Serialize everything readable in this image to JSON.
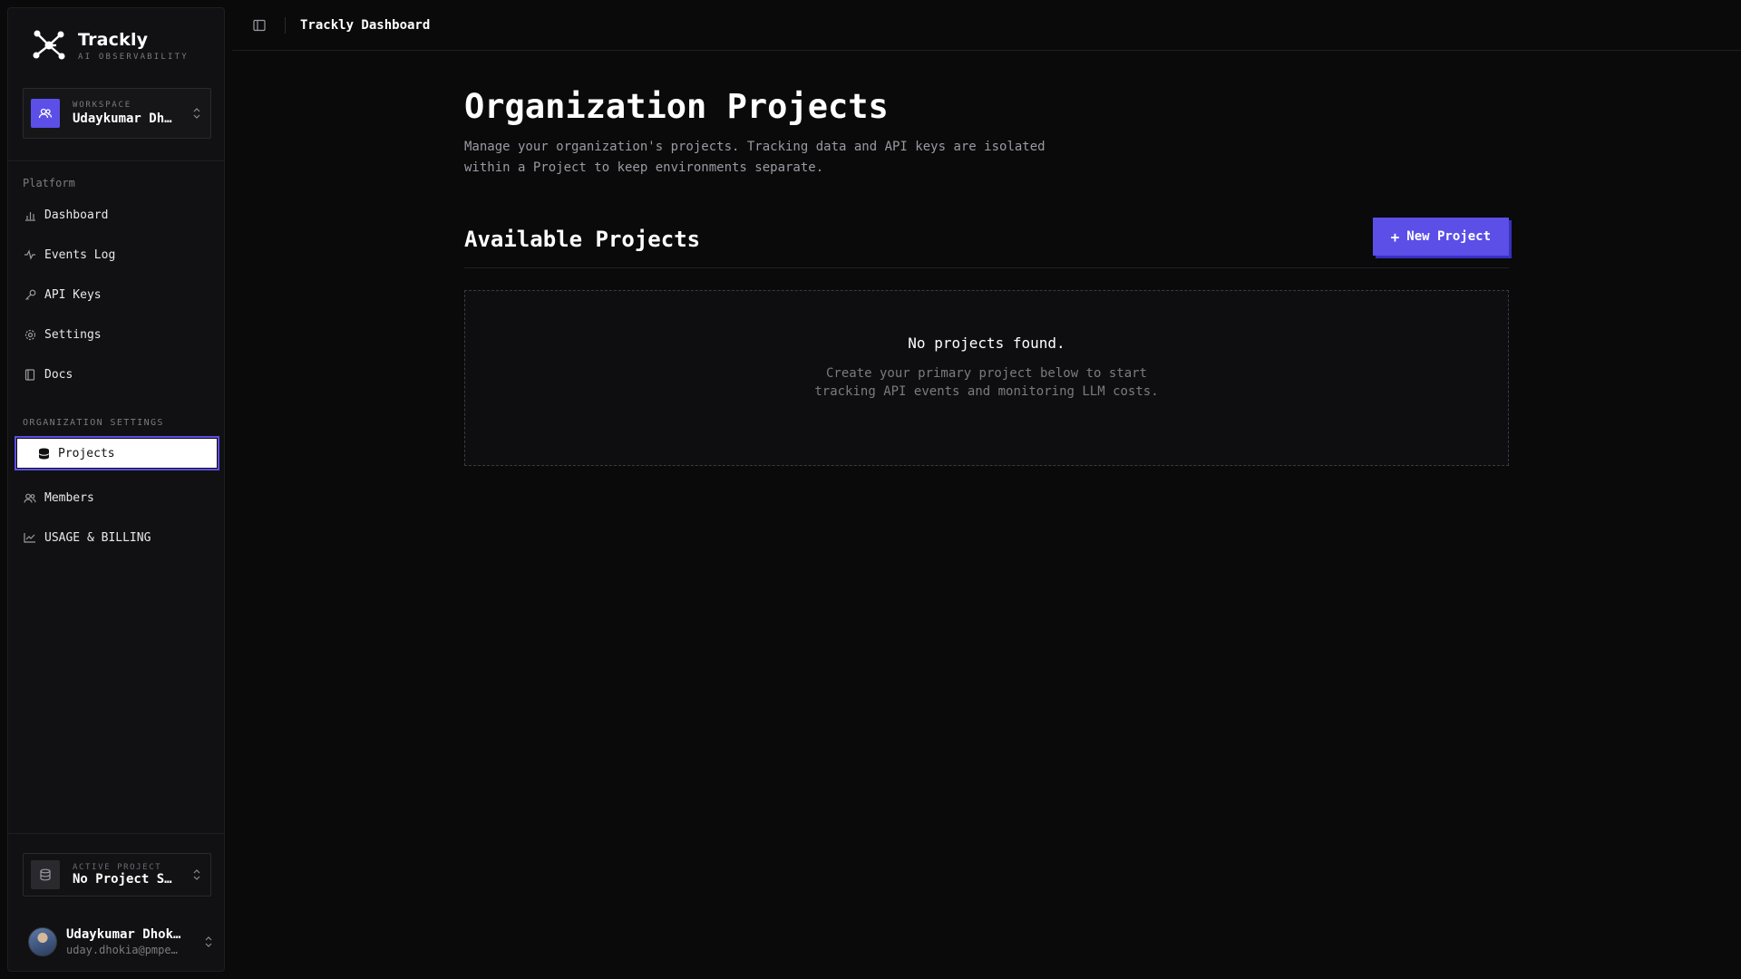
{
  "brand": {
    "name": "Trackly",
    "tagline": "AI OBSERVABILITY"
  },
  "workspace": {
    "label": "WORKSPACE",
    "name": "Udaykumar Dh…"
  },
  "nav": {
    "platform_label": "Platform",
    "platform_items": [
      {
        "label": "Dashboard",
        "icon": "bar-chart-icon"
      },
      {
        "label": "Events Log",
        "icon": "activity-icon"
      },
      {
        "label": "API Keys",
        "icon": "key-icon"
      },
      {
        "label": "Settings",
        "icon": "gear-icon"
      },
      {
        "label": "Docs",
        "icon": "book-icon"
      }
    ],
    "org_label": "ORGANIZATION SETTINGS",
    "org_items": [
      {
        "label": "Projects",
        "icon": "database-icon",
        "active": true
      },
      {
        "label": "Members",
        "icon": "users-icon"
      },
      {
        "label": "USAGE & BILLING",
        "icon": "line-chart-icon"
      }
    ]
  },
  "active_project": {
    "label": "ACTIVE PROJECT",
    "name": "No Project S…"
  },
  "user": {
    "name": "Udaykumar Dhok…",
    "email": "uday.dhokia@pmpe…"
  },
  "topbar": {
    "title": "Trackly Dashboard"
  },
  "main": {
    "title": "Organization Projects",
    "description": "Manage your organization's projects. Tracking data and API keys are isolated within a Project to keep environments separate.",
    "section_title": "Available Projects",
    "new_button": "New Project",
    "empty_title": "No projects found.",
    "empty_subtitle": "Create your primary project below to start tracking API events and monitoring LLM costs."
  },
  "colors": {
    "accent": "#5b4fe8",
    "background": "#0a0a0b",
    "sidebar": "#111113"
  }
}
